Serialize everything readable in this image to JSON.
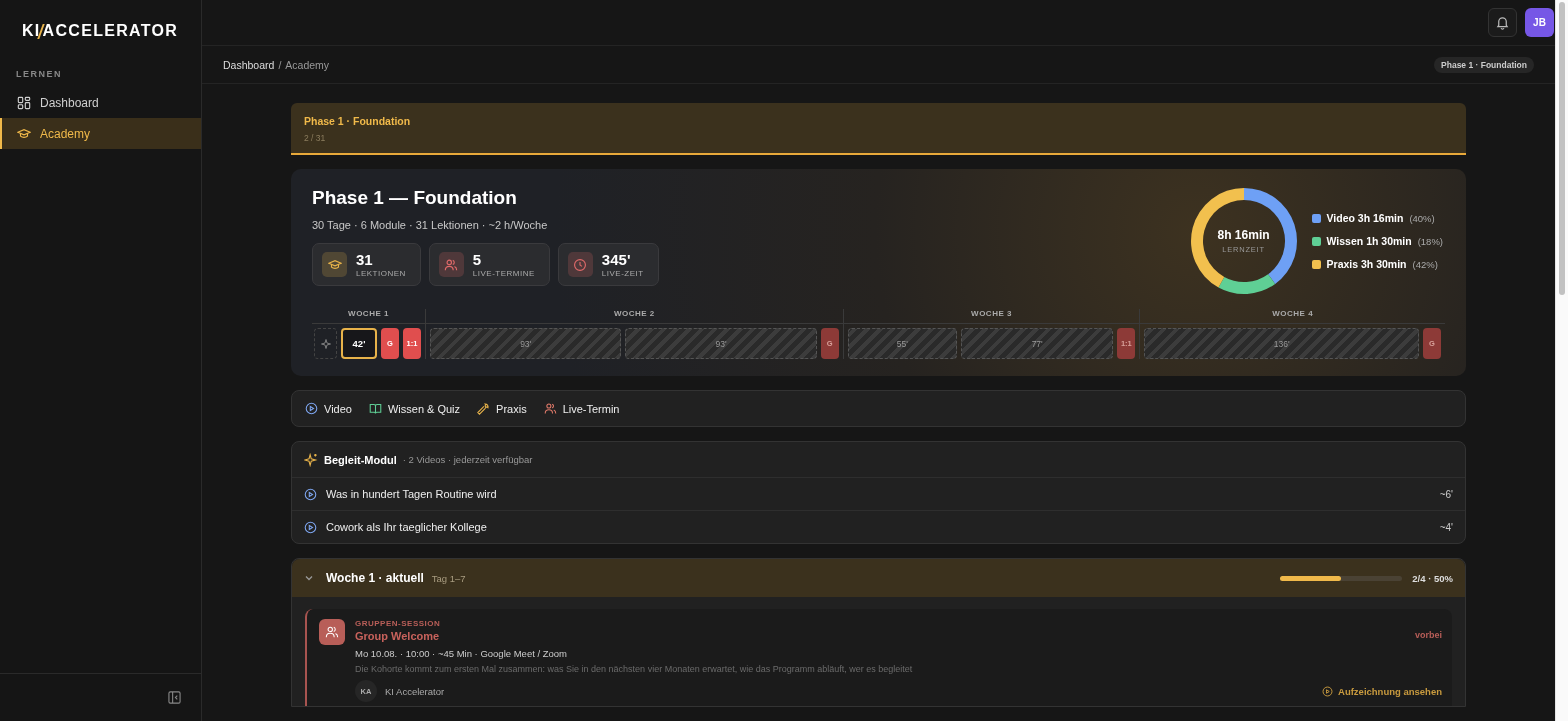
{
  "brand": {
    "logo_left": "KI",
    "logo_right": "ACCELERATOR"
  },
  "sidebar": {
    "section": "LERNEN",
    "items": [
      {
        "label": "Dashboard",
        "selected": false
      },
      {
        "label": "Academy",
        "selected": true
      }
    ]
  },
  "topbar": {
    "avatar": "JB"
  },
  "breadcrumb": {
    "parent": "Dashboard",
    "separator": "/",
    "current": "Academy",
    "badge": "Phase 1 · Foundation"
  },
  "phase_banner": {
    "title": "Phase 1 · Foundation",
    "progress": "2 / 31"
  },
  "hero": {
    "title": "Phase 1 — Foundation",
    "subtitle": "30 Tage · 6 Module · 31 Lektionen · ~2 h/Woche",
    "stats": [
      {
        "value": "31",
        "label": "LEKTIONEN"
      },
      {
        "value": "5",
        "label": "LIVE-TERMINE"
      },
      {
        "value": "345'",
        "label": "LIVE-ZEIT"
      }
    ],
    "weeks": [
      {
        "label": "WOCHE 1",
        "segments": [
          {
            "kind": "bonus"
          },
          {
            "kind": "current",
            "label": "42'"
          },
          {
            "kind": "live",
            "label": "G",
            "locked": false
          },
          {
            "kind": "live",
            "label": "1:1",
            "locked": false
          }
        ]
      },
      {
        "label": "WOCHE 2",
        "segments": [
          {
            "kind": "block",
            "label": "93'"
          },
          {
            "kind": "block",
            "label": "93'"
          },
          {
            "kind": "live",
            "label": "G",
            "locked": true
          }
        ]
      },
      {
        "label": "WOCHE 3",
        "segments": [
          {
            "kind": "block",
            "label": "55'"
          },
          {
            "kind": "block",
            "label": "77'"
          },
          {
            "kind": "live",
            "label": "1:1",
            "locked": true
          }
        ]
      },
      {
        "label": "WOCHE 4",
        "segments": [
          {
            "kind": "block",
            "label": "136'"
          },
          {
            "kind": "live",
            "label": "G",
            "locked": true
          }
        ]
      }
    ],
    "donut": {
      "total": "8h 16min",
      "caption": "LERNZEIT",
      "legend": [
        {
          "label": "Video 3h 16min",
          "share": "(40%)",
          "color": "#6ea0f5"
        },
        {
          "label": "Wissen 1h 30min",
          "share": "(18%)",
          "color": "#5fcf95"
        },
        {
          "label": "Praxis 3h 30min",
          "share": "(42%)",
          "color": "#f2c04e"
        }
      ],
      "chart_data": {
        "type": "donut",
        "values": [
          40,
          18,
          42
        ]
      }
    }
  },
  "legend": [
    {
      "label": "Video"
    },
    {
      "label": "Wissen & Quiz"
    },
    {
      "label": "Praxis"
    },
    {
      "label": "Live-Termin"
    }
  ],
  "companion": {
    "title": "Begleit-Modul",
    "meta": "· 2 Videos · jederzeit verfügbar",
    "lessons": [
      {
        "title": "Was in hundert Tagen Routine wird",
        "duration": "~6'"
      },
      {
        "title": "Cowork als Ihr taeglicher Kollege",
        "duration": "~4'"
      }
    ]
  },
  "week": {
    "title": "Woche 1 · aktuell",
    "days": "Tag 1–7",
    "expanded": true,
    "level": 0.5,
    "progress": "2/4 · 50%",
    "sessions": [
      {
        "type": "GRUPPEN-SESSION",
        "title": "Group Welcome",
        "status": "vorbei",
        "meta": "Mo 10.08. · 10:00 · ~45 Min · Google Meet / Zoom",
        "description": "Die Kohorte kommt zum ersten Mal zusammen: was Sie in den nächsten vier Monaten erwartet, wie das Programm abläuft, wer es begleitet",
        "host_initials": "KA",
        "host": "KI Accelerator",
        "action": "Aufzeichnung ansehen"
      }
    ]
  }
}
